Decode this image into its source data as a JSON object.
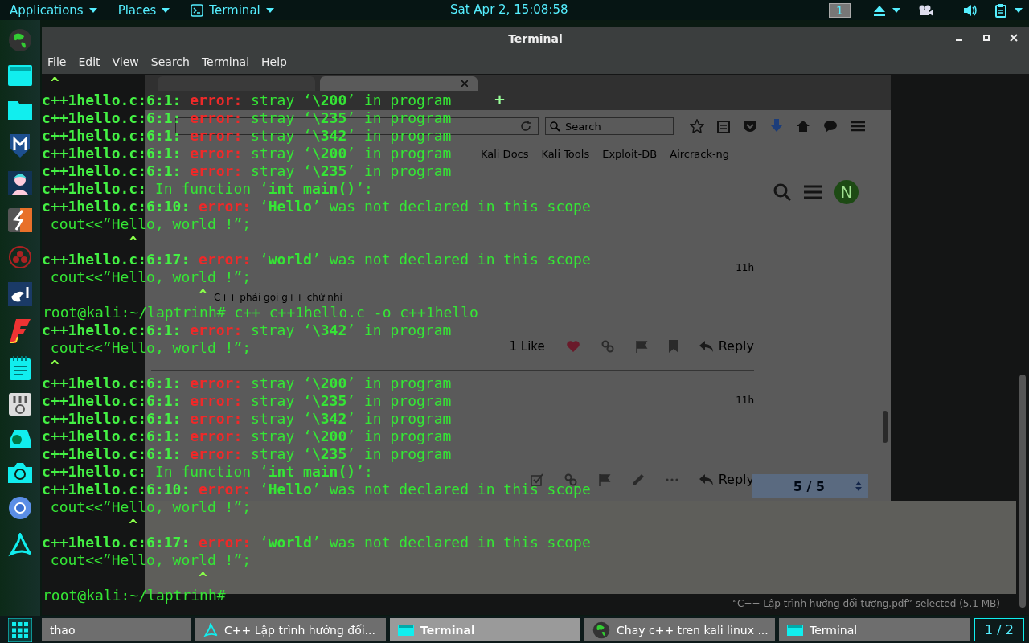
{
  "top_bar": {
    "menus": [
      {
        "label": "Applications",
        "icon": false
      },
      {
        "label": "Places",
        "icon": false
      },
      {
        "label": "Terminal",
        "icon": true
      }
    ],
    "clock": "Sat Apr  2, 15:08:58",
    "workspace": "1"
  },
  "window": {
    "title": "Terminal",
    "menu": [
      "File",
      "Edit",
      "View",
      "Search",
      "Terminal",
      "Help"
    ]
  },
  "terminal": {
    "lines": [
      {
        "kind": "caret",
        "text": " ^"
      },
      {
        "kind": "error",
        "location": "c++1hello.c:6:1:",
        "label": "error:",
        "message": "stray ‘**\\200**’ in program"
      },
      {
        "kind": "error",
        "location": "c++1hello.c:6:1:",
        "label": "error:",
        "message": "stray ‘**\\235**’ in program"
      },
      {
        "kind": "error",
        "location": "c++1hello.c:6:1:",
        "label": "error:",
        "message": "stray ‘**\\342**’ in program"
      },
      {
        "kind": "error",
        "location": "c++1hello.c:6:1:",
        "label": "error:",
        "message": "stray ‘**\\200**’ in program"
      },
      {
        "kind": "error",
        "location": "c++1hello.c:6:1:",
        "label": "error:",
        "message": "stray ‘**\\235**’ in program"
      },
      {
        "kind": "note",
        "location": "c++1hello.c:",
        "message": "In function ‘**int main()**’:"
      },
      {
        "kind": "error",
        "location": "c++1hello.c:6:10:",
        "label": "error:",
        "message": "‘**Hello**’ was not declared in this scope"
      },
      {
        "kind": "code",
        "text": " cout<<”Hello, world !”;"
      },
      {
        "kind": "caret",
        "text": "          ^"
      },
      {
        "kind": "error",
        "location": "c++1hello.c:6:17:",
        "label": "error:",
        "message": "‘**world**’ was not declared in this scope"
      },
      {
        "kind": "code",
        "text": " cout<<”Hello, world !”;"
      },
      {
        "kind": "caret",
        "text": "                  ^"
      },
      {
        "kind": "prompt",
        "prompt": "root@kali:~/laptrinh#",
        "command": "c++ c++1hello.c -o c++1hello"
      },
      {
        "kind": "error",
        "location": "c++1hello.c:6:1:",
        "label": "error:",
        "message": "stray ‘**\\342**’ in program"
      },
      {
        "kind": "code",
        "text": " cout<<”Hello, world !”;"
      },
      {
        "kind": "caret",
        "text": " ^"
      },
      {
        "kind": "error",
        "location": "c++1hello.c:6:1:",
        "label": "error:",
        "message": "stray ‘**\\200**’ in program"
      },
      {
        "kind": "error",
        "location": "c++1hello.c:6:1:",
        "label": "error:",
        "message": "stray ‘**\\235**’ in program"
      },
      {
        "kind": "error",
        "location": "c++1hello.c:6:1:",
        "label": "error:",
        "message": "stray ‘**\\342**’ in program"
      },
      {
        "kind": "error",
        "location": "c++1hello.c:6:1:",
        "label": "error:",
        "message": "stray ‘**\\200**’ in program"
      },
      {
        "kind": "error",
        "location": "c++1hello.c:6:1:",
        "label": "error:",
        "message": "stray ‘**\\235**’ in program"
      },
      {
        "kind": "note",
        "location": "c++1hello.c:",
        "message": "In function ‘**int main()**’:"
      },
      {
        "kind": "error",
        "location": "c++1hello.c:6:10:",
        "label": "error:",
        "message": "‘**Hello**’ was not declared in this scope"
      },
      {
        "kind": "code",
        "text": " cout<<”Hello, world !”;"
      },
      {
        "kind": "caret",
        "text": "          ^"
      },
      {
        "kind": "error",
        "location": "c++1hello.c:6:17:",
        "label": "error:",
        "message": "‘**world**’ was not declared in this scope"
      },
      {
        "kind": "code",
        "text": " cout<<”Hello, world !”;"
      },
      {
        "kind": "caret",
        "text": "                  ^"
      },
      {
        "kind": "prompt",
        "prompt": "root@kali:~/laptrinh#"
      }
    ]
  },
  "browser": {
    "tabs": [
      {
        "selected": false
      },
      {
        "selected": true
      }
    ],
    "new_tab": "+",
    "search": {
      "placeholder": "Search"
    },
    "bookmarks": [
      "Kali Docs",
      "Kali Tools",
      "Exploit-DB",
      "Aircrack-ng"
    ],
    "user_avatar": "N",
    "posts": [
      {
        "kind": "liked",
        "time": "11h",
        "body": "C++ phải gọi g++ chứ nhỉ",
        "likes": "1 Like",
        "reply": "Reply"
      },
      {
        "kind": "own",
        "time": "11h",
        "reply": "Reply"
      }
    ],
    "progress": "5 / 5"
  },
  "pdf": {
    "status": "“C++ Lập trình hướng đối tượng.pdf” selected (5.1 MB)"
  },
  "taskbar": {
    "items": [
      {
        "kind": "none",
        "label": "thao",
        "selected": false
      },
      {
        "kind": "pdf",
        "label": "C++ Lập trình hướng đối...",
        "selected": false
      },
      {
        "kind": "terminal",
        "label": "Terminal",
        "selected": true
      },
      {
        "kind": "globe",
        "label": "Chay c++ tren kali linux ...",
        "selected": false
      },
      {
        "kind": "terminal",
        "label": "Terminal",
        "selected": false
      }
    ],
    "workspace": "1 / 2"
  }
}
